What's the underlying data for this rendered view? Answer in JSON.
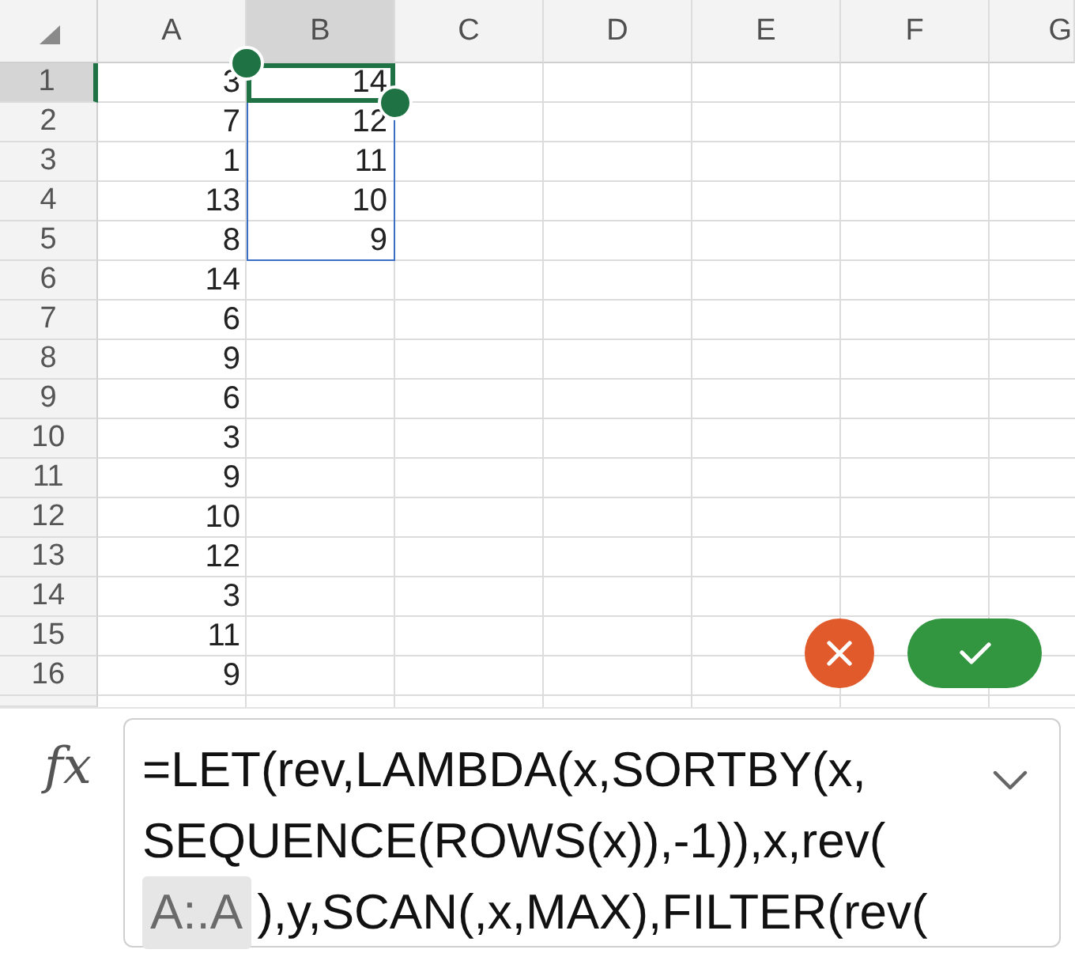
{
  "sheet": {
    "columns": [
      {
        "label": "A",
        "selected": false
      },
      {
        "label": "B",
        "selected": true
      },
      {
        "label": "C",
        "selected": false
      },
      {
        "label": "D",
        "selected": false
      },
      {
        "label": "E",
        "selected": false
      },
      {
        "label": "F",
        "selected": false
      },
      {
        "label": "G",
        "selected": false
      }
    ],
    "rows": [
      {
        "label": "1",
        "selected": true,
        "cells": [
          {
            "value": "3",
            "active": false,
            "in_range": false
          },
          {
            "value": "14",
            "active": true,
            "in_range": true
          }
        ]
      },
      {
        "label": "2",
        "selected": false,
        "cells": [
          {
            "value": "7",
            "active": false,
            "in_range": false
          },
          {
            "value": "12",
            "active": false,
            "in_range": true
          }
        ]
      },
      {
        "label": "3",
        "selected": false,
        "cells": [
          {
            "value": "1",
            "active": false,
            "in_range": false
          },
          {
            "value": "11",
            "active": false,
            "in_range": true
          }
        ]
      },
      {
        "label": "4",
        "selected": false,
        "cells": [
          {
            "value": "13",
            "active": false,
            "in_range": false
          },
          {
            "value": "10",
            "active": false,
            "in_range": true
          }
        ]
      },
      {
        "label": "5",
        "selected": false,
        "cells": [
          {
            "value": "8",
            "active": false,
            "in_range": false
          },
          {
            "value": "9",
            "active": false,
            "in_range": true
          }
        ]
      },
      {
        "label": "6",
        "selected": false,
        "cells": [
          {
            "value": "14",
            "active": false,
            "in_range": false
          }
        ]
      },
      {
        "label": "7",
        "selected": false,
        "cells": [
          {
            "value": "6",
            "active": false,
            "in_range": false
          }
        ]
      },
      {
        "label": "8",
        "selected": false,
        "cells": [
          {
            "value": "9",
            "active": false,
            "in_range": false
          }
        ]
      },
      {
        "label": "9",
        "selected": false,
        "cells": [
          {
            "value": "6",
            "active": false,
            "in_range": false
          }
        ]
      },
      {
        "label": "10",
        "selected": false,
        "cells": [
          {
            "value": "3",
            "active": false,
            "in_range": false
          }
        ]
      },
      {
        "label": "11",
        "selected": false,
        "cells": [
          {
            "value": "9",
            "active": false,
            "in_range": false
          }
        ]
      },
      {
        "label": "12",
        "selected": false,
        "cells": [
          {
            "value": "10",
            "active": false,
            "in_range": false
          }
        ]
      },
      {
        "label": "13",
        "selected": false,
        "cells": [
          {
            "value": "12",
            "active": false,
            "in_range": false
          }
        ]
      },
      {
        "label": "14",
        "selected": false,
        "cells": [
          {
            "value": "3",
            "active": false,
            "in_range": false
          }
        ]
      },
      {
        "label": "15",
        "selected": false,
        "cells": [
          {
            "value": "11",
            "active": false,
            "in_range": false
          }
        ]
      },
      {
        "label": "16",
        "selected": false,
        "cells": [
          {
            "value": "9",
            "active": false,
            "in_range": false
          }
        ]
      }
    ]
  },
  "edit_buttons": [
    {
      "kind": "cancel"
    },
    {
      "kind": "confirm"
    }
  ],
  "formula_bar": {
    "function_label": "fx",
    "lines": [
      [
        {
          "kind": "text",
          "text": "=LET(rev,LAMBDA(x,SORTBY(x,"
        }
      ],
      [
        {
          "kind": "text",
          "text": "SEQUENCE(ROWS(x)),-1)),x,rev("
        }
      ],
      [
        {
          "kind": "reference",
          "text": "A:.A"
        },
        {
          "kind": "text",
          "text": "),y,SCAN(,x,MAX),FILTER(rev("
        }
      ]
    ]
  }
}
